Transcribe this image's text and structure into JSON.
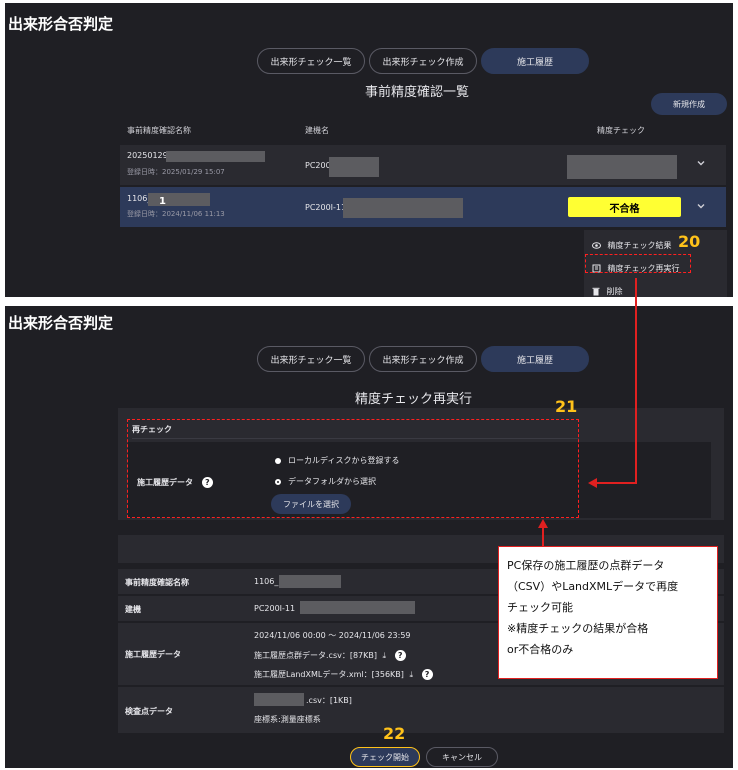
{
  "top": {
    "app_title": "出来形合否判定",
    "tabs": [
      "出来形チェック一覧",
      "出来形チェック作成",
      "施工履歴"
    ],
    "section_title": "事前精度確認一覧",
    "new_button": "新規作成",
    "columns": [
      "事前精度確認名称",
      "建機名",
      "精度チェック"
    ],
    "rows": [
      {
        "name": "20250129_",
        "date": "登録日時：2025/01/29 15:07",
        "machine": "PC200",
        "result": ""
      },
      {
        "name": "1106_",
        "date": "登録日時：2024/11/06 11:13",
        "machine": "PC200I-11",
        "result": "不合格"
      }
    ],
    "menu": [
      "精度チェック結果",
      "精度チェック再実行",
      "削除"
    ],
    "marker1": "1",
    "marker20": "20"
  },
  "bottom": {
    "app_title": "出来形合否判定",
    "tabs": [
      "出来形チェック一覧",
      "出来形チェック作成",
      "施工履歴"
    ],
    "section_title": "精度チェック再実行",
    "recheck_header": "再チェック",
    "history_label": "施工履歴データ",
    "radio_local": "ローカルディスクから登録する",
    "radio_folder": "データフォルダから選択",
    "file_button": "ファイルを選択",
    "marker21": "21",
    "info": {
      "name_label": "事前精度確認名称",
      "name_value": "1106_",
      "machine_label": "建機",
      "machine_value": "PC200I-11",
      "history_label": "施工履歴データ",
      "history_range": "2024/11/06 00:00 ～ 2024/11/06 23:59",
      "history_csv": "施工履歴点群データ.csv：[87KB]",
      "history_xml": "施工履歴LandXMLデータ.xml：[356KB]",
      "check_label": "検査点データ",
      "check_csv": ".csv：[1KB]",
      "check_coord": "座標系:測量座標系"
    },
    "start_button": "チェック開始",
    "cancel_button": "キャンセル",
    "marker22": "22"
  },
  "callout": {
    "line1": "PC保存の施工履歴の点群データ",
    "line2": "（CSV）やLandXMLデータで再度",
    "line3": "チェック可能",
    "line4": "※精度チェックの結果が合格",
    "line5": "or不合格のみ"
  },
  "colors": {
    "panel": "#1f1f24",
    "row": "#2a2a30",
    "active": "#2d3a5a",
    "fail": "#ffff33",
    "annotation": "#e02020",
    "marker": "#ffc21a"
  },
  "icons": [
    "chevron-down-icon",
    "eye-icon",
    "rerun-icon",
    "trash-icon",
    "help-icon",
    "download-icon"
  ]
}
